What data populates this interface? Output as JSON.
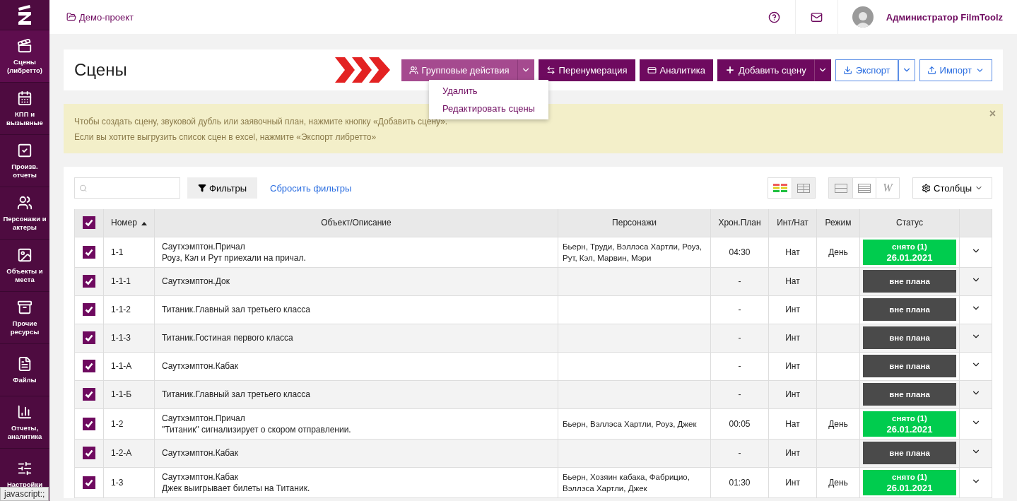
{
  "sidebar": {
    "items": [
      {
        "label": "Сцены (либретто)",
        "selected": true
      },
      {
        "label": "КПП и вызывные",
        "selected": false
      },
      {
        "label": "Произв. отчеты",
        "selected": false
      },
      {
        "label": "Персонажи и актеры",
        "selected": false
      },
      {
        "label": "Объекты и места",
        "selected": false
      },
      {
        "label": "Прочие ресурсы",
        "selected": false
      },
      {
        "label": "Файлы",
        "selected": false
      },
      {
        "label": "Отчеты, аналитика",
        "selected": false
      },
      {
        "label": "Настройки",
        "selected": false
      }
    ]
  },
  "topbar": {
    "project": "Демо-проект",
    "user": "Администратор FilmToolz"
  },
  "header": {
    "title": "Сцены",
    "group_actions": "Групповые действия",
    "renumber": "Перенумерация",
    "analytics": "Аналитика",
    "add_scene": "Добавить сцену",
    "export": "Экспорт",
    "import": "Импорт",
    "menu": [
      "Удалить",
      "Редактировать сцены"
    ]
  },
  "alert": {
    "lines": [
      "Чтобы создать сцену, звуковой дубль или заявочный план, нажмите кнопку «Добавить сцену».",
      "Если вы хотите выгрузить список сцен в excel, нажмите «Экспорт либретто»"
    ],
    "close": "×"
  },
  "toolbar": {
    "filters": "Фильтры",
    "reset": "Сбросить фильтры",
    "wrap": "W",
    "columns": "Столбцы",
    "color_view_selected": false,
    "compact_selected": true
  },
  "table": {
    "all_checked": true,
    "columns": [
      "Номер",
      "Объект/Описание",
      "Персонажи",
      "Хрон.План",
      "Инт/Нат",
      "Режим",
      "Статус"
    ],
    "rows": [
      {
        "checked": true,
        "number": "1-1",
        "object": "Саутхэмптон.Причал",
        "description": "Роуз, Кэл и Рут приехали на причал.",
        "characters": "Бьерн, Труди, Вэллэса Хартли, Роуз, Рут, Кэл, Марвин, Мэри",
        "duration": "04:30",
        "int_ext": "Нат",
        "mode": "День",
        "status": {
          "kind": "shot",
          "label": "снято (1)",
          "date": "26.01.2021"
        }
      },
      {
        "checked": true,
        "number": "1-1-1",
        "object": "Саутхэмптон.Док",
        "duration": "-",
        "int_ext": "Нат",
        "status": {
          "kind": "unplanned",
          "label": "вне плана"
        }
      },
      {
        "checked": true,
        "number": "1-1-2",
        "object": "Титаник.Главный зал третьего класса",
        "duration": "-",
        "int_ext": "Инт",
        "status": {
          "kind": "unplanned",
          "label": "вне плана"
        }
      },
      {
        "checked": true,
        "number": "1-1-3",
        "object": "Титаник.Гостиная первого класса",
        "duration": "-",
        "int_ext": "Инт",
        "status": {
          "kind": "unplanned",
          "label": "вне плана"
        }
      },
      {
        "checked": true,
        "number": "1-1-А",
        "object": "Саутхэмптон.Кабак",
        "duration": "-",
        "int_ext": "Инт",
        "status": {
          "kind": "unplanned",
          "label": "вне плана"
        }
      },
      {
        "checked": true,
        "number": "1-1-Б",
        "object": "Титаник.Главный зал третьего класса",
        "duration": "-",
        "int_ext": "Инт",
        "status": {
          "kind": "unplanned",
          "label": "вне плана"
        }
      },
      {
        "checked": true,
        "number": "1-2",
        "object": "Саутхэмптон.Причал",
        "description": "\"Титаник\" сигнализирует о скором отправлении.",
        "characters": "Бьерн, Вэллэса Хартли, Роуз, Джек",
        "duration": "00:05",
        "int_ext": "Нат",
        "mode": "День",
        "status": {
          "kind": "shot",
          "label": "снято (1)",
          "date": "26.01.2021"
        }
      },
      {
        "checked": true,
        "number": "1-2-А",
        "object": "Саутхэмптон.Кабак",
        "duration": "-",
        "int_ext": "Инт",
        "status": {
          "kind": "unplanned",
          "label": "вне плана"
        }
      },
      {
        "checked": true,
        "number": "1-3",
        "object": "Саутхэмптон.Кабак",
        "description": "Джек выигрывает билеты на Титаник.",
        "characters": "Бьерн, Хозяин кабака, Фабрицио, Вэллэса Хартли, Джек",
        "duration": "01:30",
        "int_ext": "Инт",
        "mode": "День",
        "status": {
          "kind": "shot",
          "label": "снято (1)",
          "date": "26.01.2021"
        }
      }
    ]
  },
  "browser_status": "javascript:;"
}
